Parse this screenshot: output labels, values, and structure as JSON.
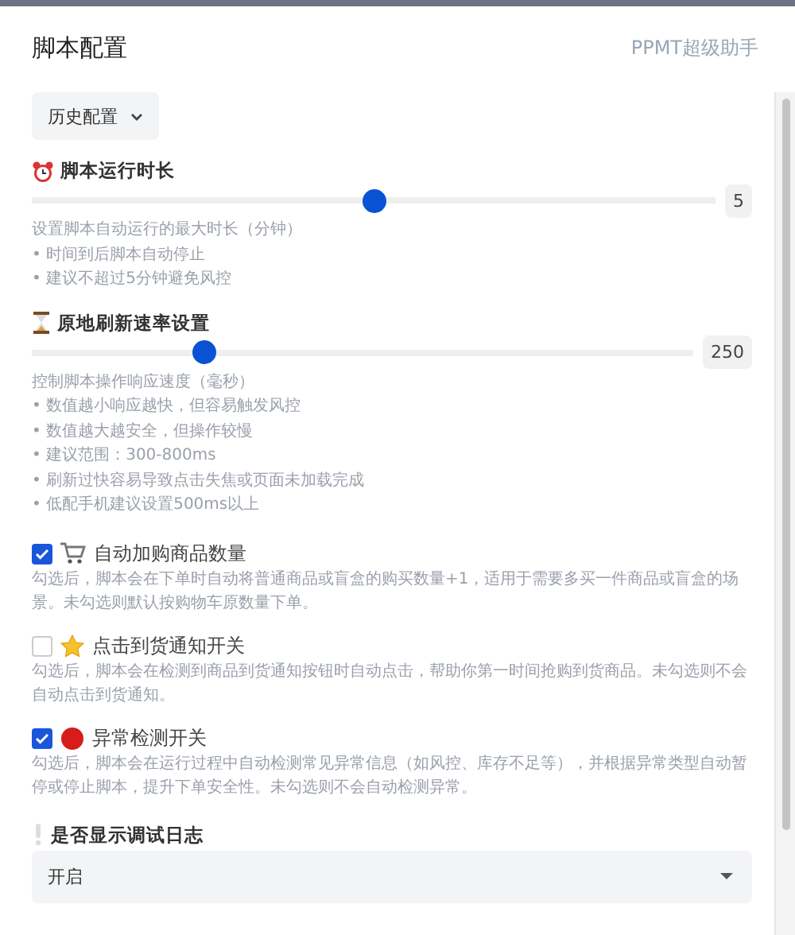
{
  "header": {
    "title": "脚本配置",
    "brand": "PPMT超级助手"
  },
  "history_button": {
    "label": "历史配置"
  },
  "sliders": [
    {
      "kind": "clock",
      "title": "脚本运行时长",
      "level": 0.5,
      "reading": "5",
      "description": "设置脚本自动运行的最大时长（分钟）",
      "bullets": [
        "• 时间到后脚本自动停止",
        "• 建议不超过5分钟避免风控"
      ]
    },
    {
      "kind": "hourglass",
      "title": "原地刷新速率设置",
      "level": 0.26,
      "reading": "250",
      "description": "控制脚本操作响应速度（毫秒）",
      "bullets": [
        "• 数值越小响应越快，但容易触发风控",
        "• 数值越大越安全，但操作较慢",
        "• 建议范围：300-800ms",
        "• 刷新过快容易导致点击失焦或页面未加载完成",
        "• 低配手机建议设置500ms以上"
      ]
    }
  ],
  "options": [
    {
      "kind": "cart",
      "label": "自动加购商品数量",
      "checked": true,
      "description": "勾选后，脚本会在下单时自动将普通商品或盲盒的购买数量+1，适用于需要多买一件商品或盲盒的场景。未勾选则默认按购物车原数量下单。"
    },
    {
      "kind": "star",
      "label": "点击到货通知开关",
      "checked": false,
      "description": "勾选后，脚本会在检测到商品到货通知按钮时自动点击，帮助你第一时间抢购到货商品。未勾选则不会自动点击到货通知。"
    },
    {
      "kind": "dot",
      "label": "异常检测开关",
      "checked": true,
      "description": "勾选后，脚本会在运行过程中自动检测常见异常信息（如风控、库存不足等），并根据异常类型自动暂停或停止脚本，提升下单安全性。未勾选则不会自动检测异常。"
    }
  ],
  "debug": {
    "label": "是否显示调试日志",
    "value": "开启"
  }
}
